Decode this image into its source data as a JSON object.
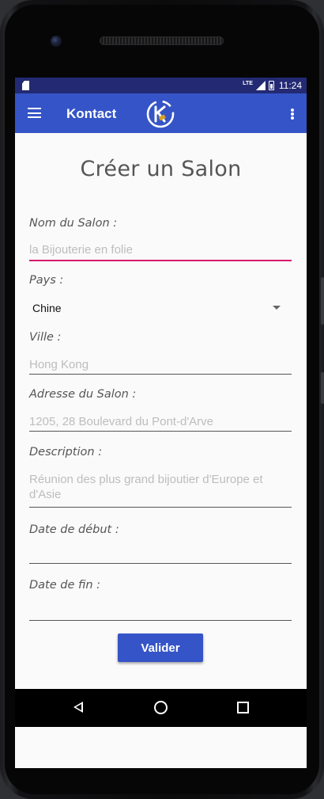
{
  "status_bar": {
    "network": "LTE",
    "time": "11:24"
  },
  "toolbar": {
    "title": "Kontact",
    "logo_letter": "K",
    "accent": "#3554c7"
  },
  "form": {
    "title": "Créer un Salon",
    "salon_name": {
      "label": "Nom du Salon :",
      "value": "la Bijouterie en folie"
    },
    "country": {
      "label": "Pays :",
      "selected": "Chine"
    },
    "city": {
      "label": "Ville :",
      "placeholder": "Hong Kong"
    },
    "address": {
      "label": "Adresse du Salon :",
      "placeholder": "1205, 28 Boulevard du Pont-d'Arve"
    },
    "description": {
      "label": "Description :",
      "placeholder": "Réunion des plus grand bijoutier d'Europe et d'Asie"
    },
    "start_date": {
      "label": "Date de début :",
      "value": ""
    },
    "end_date": {
      "label": "Date de fin :",
      "value": ""
    },
    "submit_label": "Valider"
  },
  "colors": {
    "statusbar": "#232a73",
    "focus_underline": "#d6186b"
  }
}
